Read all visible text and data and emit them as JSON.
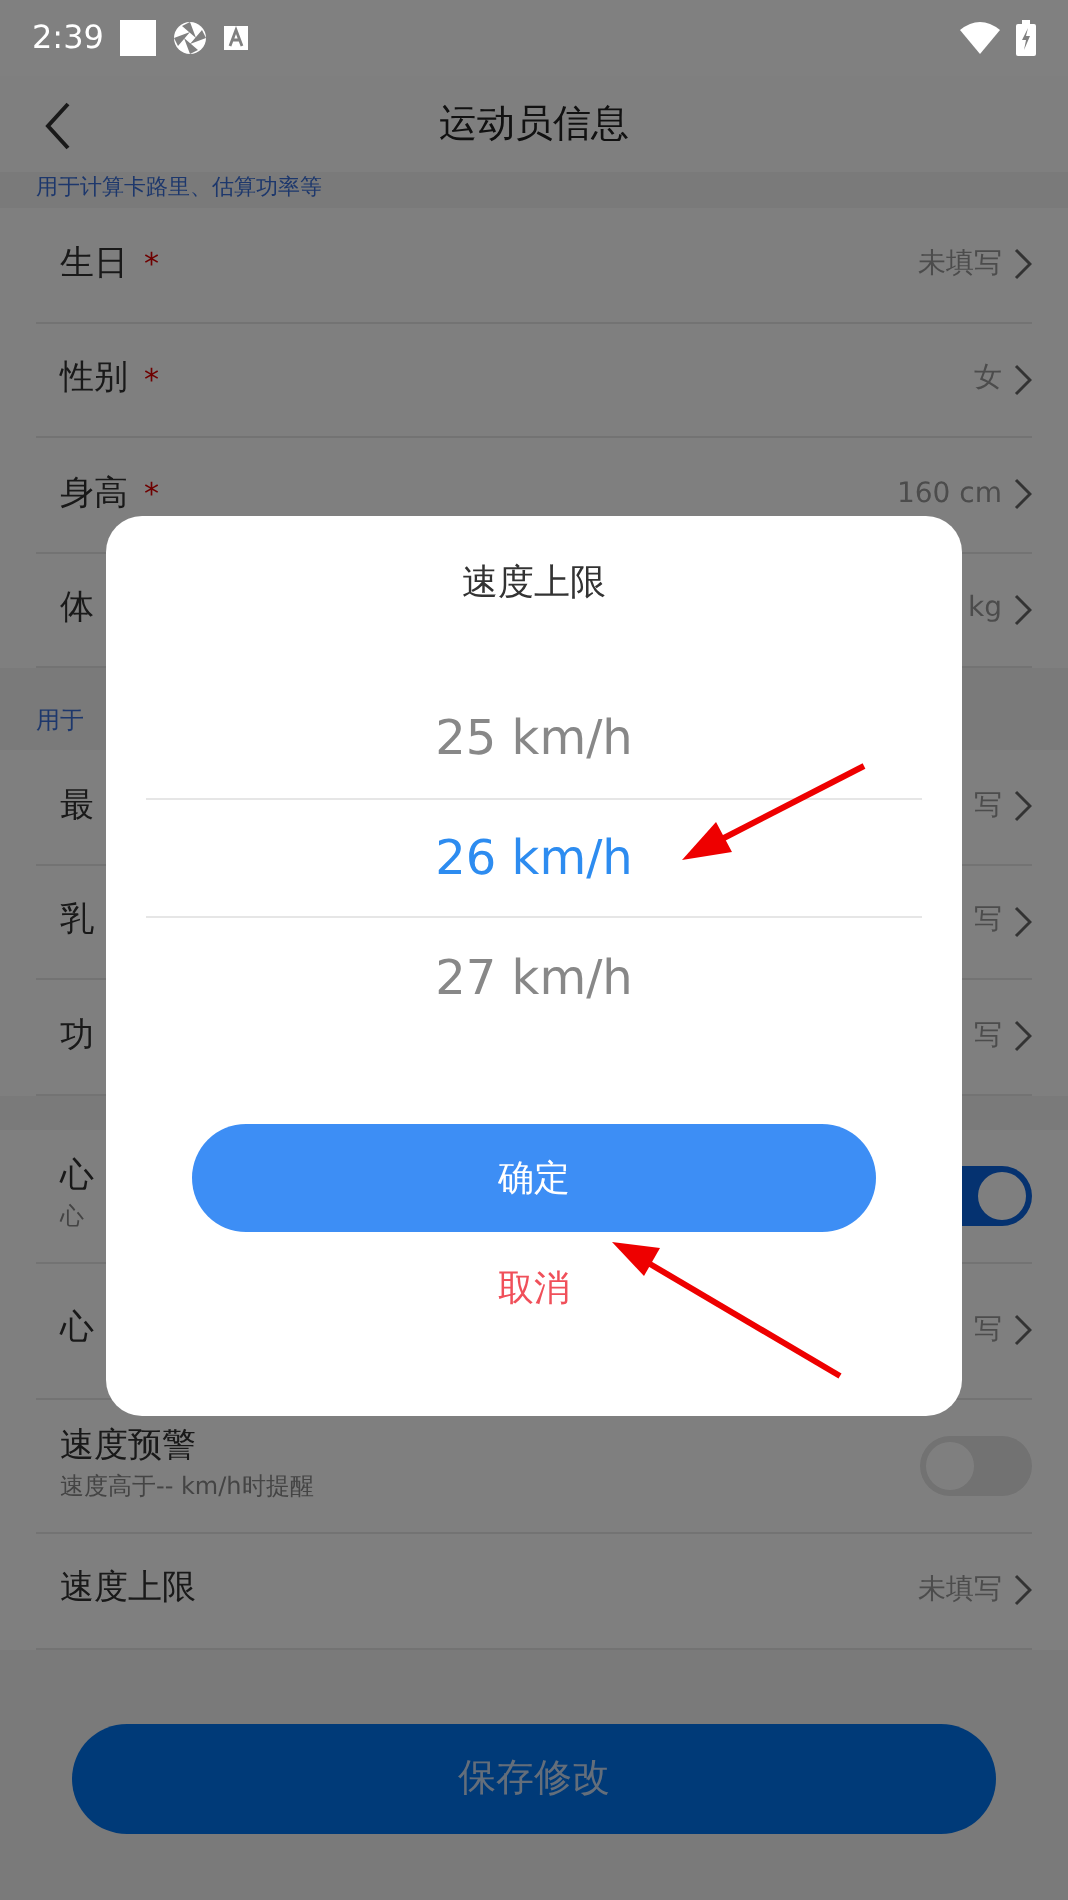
{
  "status_bar": {
    "time": "2:39"
  },
  "header": {
    "title": "运动员信息"
  },
  "sections": [
    {
      "note": "用于计算卡路里、估算功率等",
      "rows": [
        {
          "kind": "nav",
          "label": "生日",
          "mark": "*",
          "value": "未填写"
        },
        {
          "kind": "nav",
          "label": "性别",
          "mark": "*",
          "value": "女"
        },
        {
          "kind": "nav",
          "label": "身高",
          "mark": "*",
          "value": "160 cm"
        },
        {
          "kind": "nav",
          "label": "体",
          "value": "kg"
        }
      ]
    },
    {
      "note": "用于",
      "rows": [
        {
          "kind": "nav",
          "label": "最",
          "value": "写"
        },
        {
          "kind": "nav",
          "label": "乳",
          "value": "写"
        },
        {
          "kind": "nav",
          "label": "功",
          "value": "写"
        }
      ]
    },
    {
      "rows": [
        {
          "kind": "toggle",
          "label": "心",
          "subtitle": "心",
          "on": true
        },
        {
          "kind": "nav",
          "label": "心",
          "value": "写"
        },
        {
          "kind": "toggle",
          "label": "速度预警",
          "subtitle": "速度高于-- km/h时提醒",
          "on": false
        },
        {
          "kind": "nav",
          "label": "速度上限",
          "value": "未填写"
        }
      ]
    }
  ],
  "save_button": "保存修改",
  "dialog": {
    "title": "速度上限",
    "options": [
      {
        "label": "25 km/h",
        "selected": false
      },
      {
        "label": "26 km/h",
        "selected": true
      },
      {
        "label": "27 km/h",
        "selected": false
      }
    ],
    "confirm": "确定",
    "cancel": "取消"
  }
}
